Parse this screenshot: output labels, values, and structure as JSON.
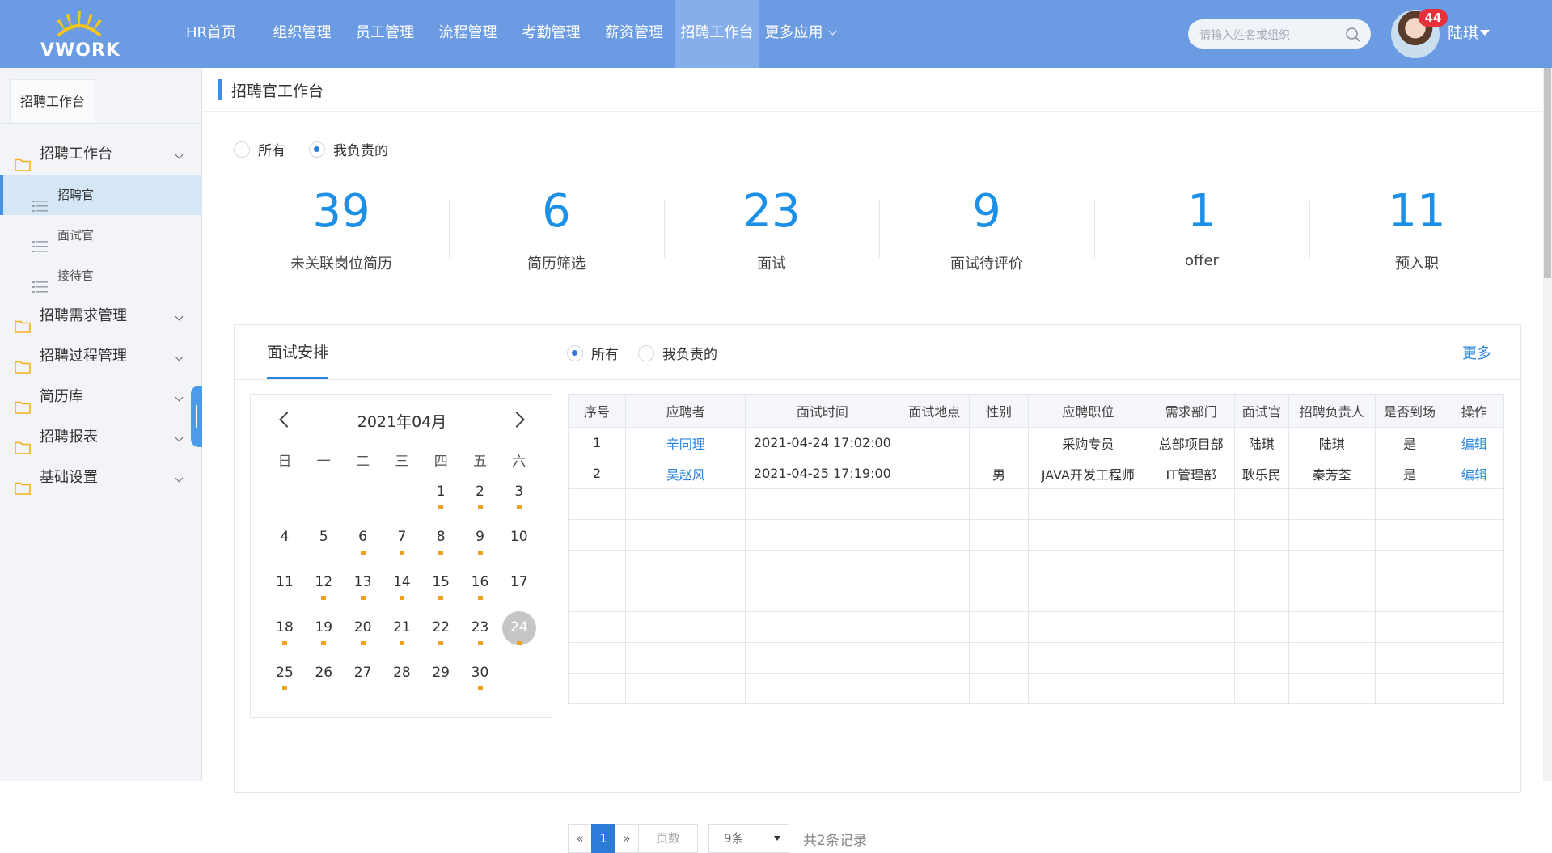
{
  "header": {
    "logo_text": "VWORK",
    "nav": [
      {
        "label": "HR首页",
        "active": false
      },
      {
        "label": "组织管理",
        "active": false
      },
      {
        "label": "员工管理",
        "active": false
      },
      {
        "label": "流程管理",
        "active": false
      },
      {
        "label": "考勤管理",
        "active": false
      },
      {
        "label": "薪资管理",
        "active": false
      },
      {
        "label": "招聘工作台",
        "active": true
      },
      {
        "label": "更多应用",
        "active": false
      }
    ],
    "search_placeholder": "请输入姓名或组织",
    "notification_count": "44",
    "username": "陆琪"
  },
  "sidebar": {
    "tab": "招聘工作台",
    "groups": [
      {
        "label": "招聘工作台",
        "items": [
          {
            "label": "招聘官",
            "active": true
          },
          {
            "label": "面试官",
            "active": false
          },
          {
            "label": "接待官",
            "active": false
          }
        ]
      },
      {
        "label": "招聘需求管理"
      },
      {
        "label": "招聘过程管理"
      },
      {
        "label": "简历库"
      },
      {
        "label": "招聘报表"
      },
      {
        "label": "基础设置"
      }
    ]
  },
  "main": {
    "title": "招聘官工作台",
    "scope_filter": {
      "options": [
        "所有",
        "我负责的"
      ],
      "selected": "我负责的"
    },
    "stats": [
      {
        "value": "39",
        "label": "未关联岗位简历"
      },
      {
        "value": "6",
        "label": "简历筛选"
      },
      {
        "value": "23",
        "label": "面试"
      },
      {
        "value": "9",
        "label": "面试待评价"
      },
      {
        "value": "1",
        "label": "offer"
      },
      {
        "value": "11",
        "label": "预入职"
      }
    ],
    "interview": {
      "tab": "面试安排",
      "filter": {
        "options": [
          "所有",
          "我负责的"
        ],
        "selected": "所有"
      },
      "more": "更多",
      "calendar": {
        "title": "2021年04月",
        "weekdays": [
          "日",
          "一",
          "二",
          "三",
          "四",
          "五",
          "六"
        ],
        "first_weekday": 4,
        "days_in_month": 30,
        "marked_days": [
          1,
          2,
          3,
          6,
          7,
          8,
          9,
          12,
          13,
          14,
          15,
          16,
          18,
          19,
          20,
          21,
          22,
          23,
          24,
          25,
          30
        ],
        "today": 24
      },
      "table": {
        "columns": [
          "序号",
          "应聘者",
          "面试时间",
          "面试地点",
          "性别",
          "应聘职位",
          "需求部门",
          "面试官",
          "招聘负责人",
          "是否到场",
          "操作"
        ],
        "rows": [
          [
            "1",
            "辛同理",
            "2021-04-24 17:02:00",
            "",
            "",
            "采购专员",
            "总部项目部",
            "陆琪",
            "陆琪",
            "是",
            "编辑"
          ],
          [
            "2",
            "吴赵风",
            "2021-04-25 17:19:00",
            "",
            "男",
            "JAVA开发工程师",
            "IT管理部",
            "耿乐民",
            "秦芳荃",
            "是",
            "编辑"
          ]
        ],
        "empty_rows": 7
      },
      "pager": {
        "prev": "«",
        "current": "1",
        "next": "»",
        "jump_placeholder": "页数",
        "page_size": "9条",
        "total": "共2条记录"
      }
    }
  },
  "colors": {
    "header_bg": "#6b9be3",
    "accent": "#1c8fe6",
    "link": "#2b84dd",
    "calendar_mark": "#f0a11d",
    "badge": "#e8303a"
  }
}
